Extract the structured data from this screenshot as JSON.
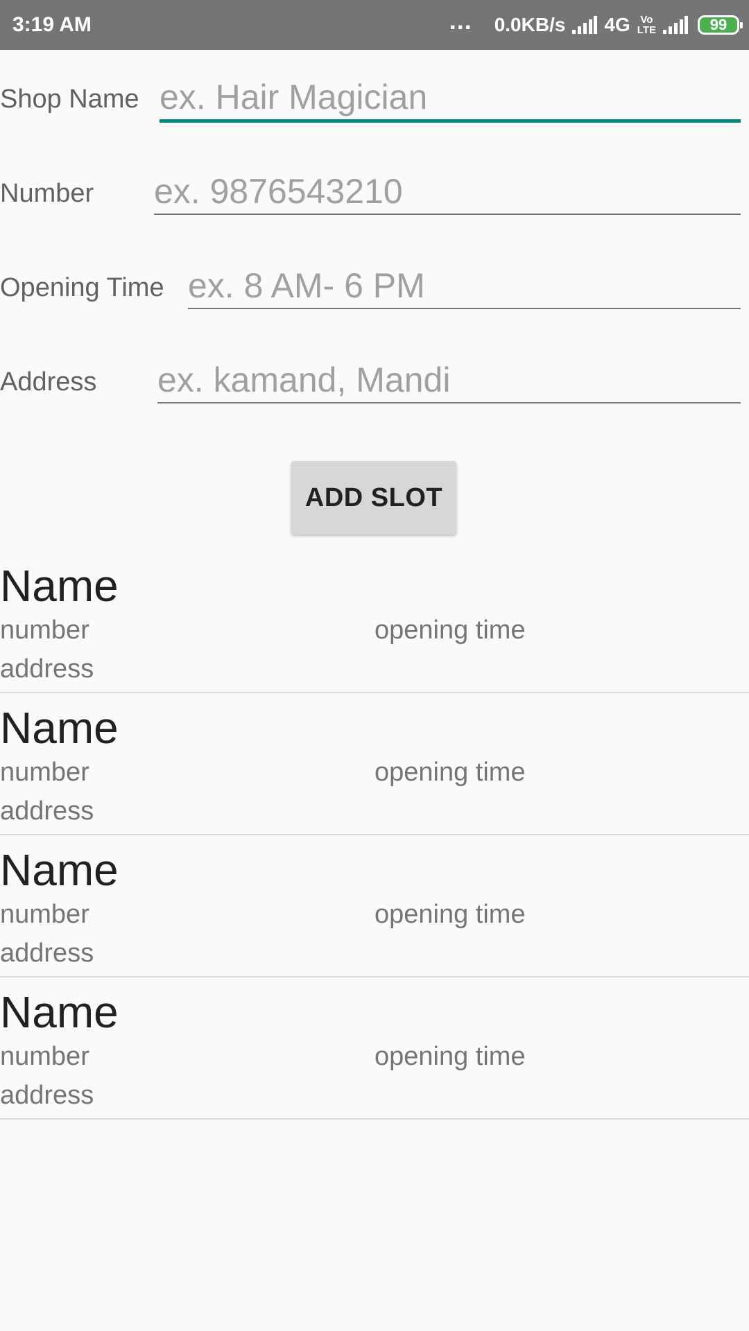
{
  "status_bar": {
    "time": "3:19 AM",
    "more": "...",
    "speed": "0.0KB/s",
    "network": "4G",
    "volte_top": "Vo",
    "volte_bottom": "LTE",
    "battery": "99",
    "icons": [
      "signal-icon",
      "signal-icon",
      "battery-icon"
    ]
  },
  "form": {
    "shop_name": {
      "label": "Shop Name",
      "placeholder": "ex. Hair Magician",
      "value": ""
    },
    "number": {
      "label": "Number",
      "placeholder": "ex. 9876543210",
      "value": ""
    },
    "opening_time": {
      "label": "Opening Time",
      "placeholder": "ex. 8 AM- 6 PM",
      "value": ""
    },
    "address": {
      "label": "Address",
      "placeholder": "ex. kamand, Mandi",
      "value": ""
    },
    "accent_color": "#00897b"
  },
  "add_slot_button": "ADD SLOT",
  "slots": [
    {
      "name": "Name",
      "number": "number",
      "opening_time": "opening time",
      "address": "address"
    },
    {
      "name": "Name",
      "number": "number",
      "opening_time": "opening time",
      "address": "address"
    },
    {
      "name": "Name",
      "number": "number",
      "opening_time": "opening time",
      "address": "address"
    },
    {
      "name": "Name",
      "number": "number",
      "opening_time": "opening time",
      "address": "address"
    }
  ]
}
